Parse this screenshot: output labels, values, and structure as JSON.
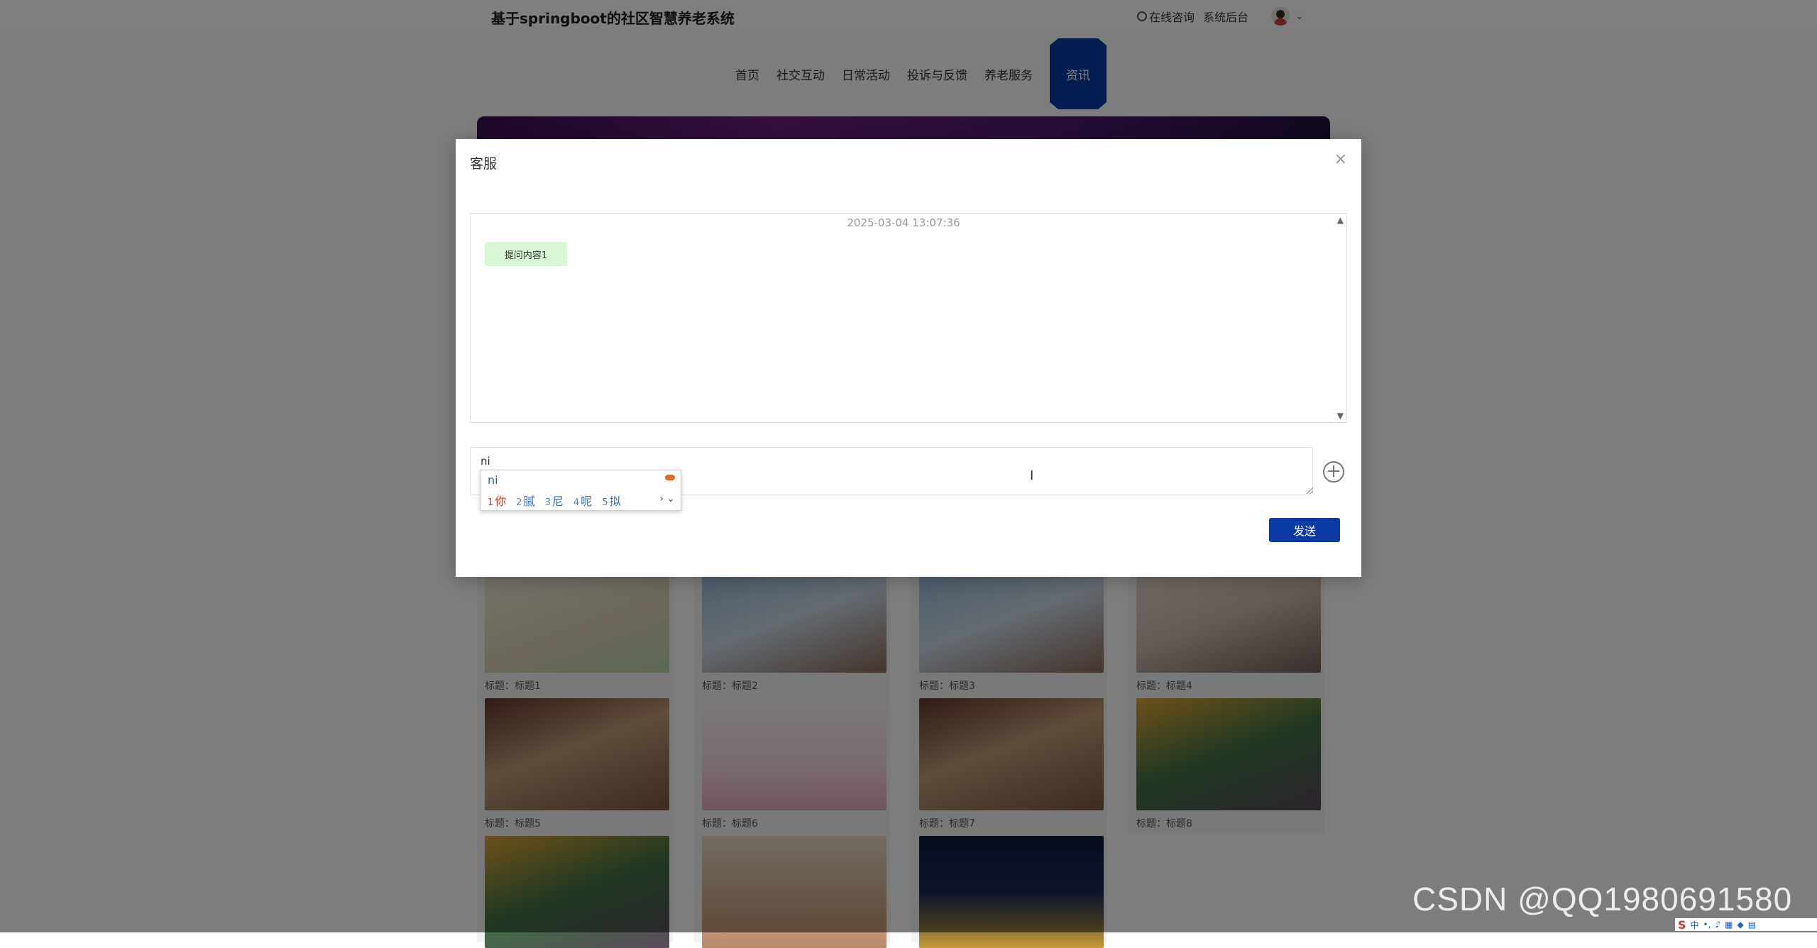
{
  "header": {
    "site_title": "基于springboot的社区智慧养老系统",
    "consult_label": "在线咨询",
    "admin_label": "系统后台"
  },
  "nav": {
    "items": [
      {
        "label": "首页"
      },
      {
        "label": "社交互动"
      },
      {
        "label": "日常活动"
      },
      {
        "label": "投诉与反馈"
      },
      {
        "label": "养老服务"
      },
      {
        "label": "资讯",
        "active": true
      }
    ]
  },
  "cards": [
    {
      "caption": "标题：标题1"
    },
    {
      "caption": "标题：标题2"
    },
    {
      "caption": "标题：标题3"
    },
    {
      "caption": "标题：标题4"
    },
    {
      "caption": "标题：标题5"
    },
    {
      "caption": "标题：标题6"
    },
    {
      "caption": "标题：标题7"
    },
    {
      "caption": "标题：标题8"
    }
  ],
  "modal": {
    "title": "客服",
    "close": "×",
    "chat": {
      "timestamp": "2025-03-04 13:07:36",
      "message": "提问内容1"
    },
    "input_value": "ni",
    "send_label": "发送"
  },
  "ime": {
    "composition": "ni",
    "candidates": [
      {
        "num": "1",
        "char": "你"
      },
      {
        "num": "2",
        "char": "腻"
      },
      {
        "num": "3",
        "char": "尼"
      },
      {
        "num": "4",
        "char": "呢"
      },
      {
        "num": "5",
        "char": "拟"
      }
    ]
  },
  "watermark": "CSDN @QQ1980691580",
  "colors": {
    "primary": "#0a3aa3",
    "bubble": "#d8f5d6"
  }
}
